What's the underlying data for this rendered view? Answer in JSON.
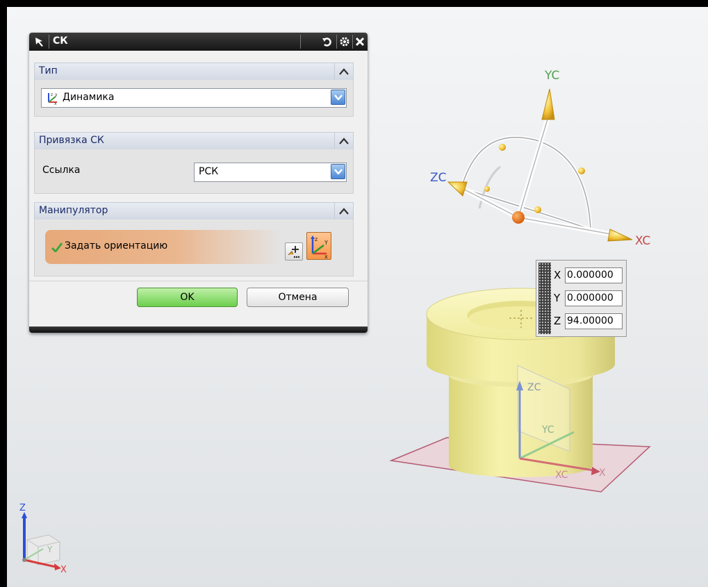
{
  "dialog": {
    "title": "СК",
    "sections": {
      "type": {
        "header": "Тип",
        "selected": "Динамика"
      },
      "snap": {
        "header": "Привязка СК",
        "reference_label": "Ссылка",
        "reference_value": "РСК"
      },
      "manipulator": {
        "header": "Манипулятор",
        "action_label": "Задать ориентацию"
      }
    },
    "ok_label": "OK",
    "cancel_label": "Отмена"
  },
  "manipulator_axes": {
    "yc": "YC",
    "zc": "ZC",
    "xc": "XC"
  },
  "coordinates": {
    "x_label": "X",
    "x_value": "0.000000",
    "y_label": "Y",
    "y_value": "0.000000",
    "z_label": "Z",
    "z_value": "94.00000"
  },
  "part_triad": {
    "zc": "ZC",
    "yc": "YC",
    "xc": "XC",
    "x": "X"
  },
  "view_triad": {
    "z": "Z",
    "y": "Y",
    "x": "X"
  },
  "colors": {
    "part_yellow": "#f2ee9c",
    "handle_orange": "#f0c33c",
    "axis_label_blue": "#3a58c8",
    "axis_label_green": "#52a052",
    "ok_green": "#6ccf4d",
    "header_blue": "#1a2a66"
  }
}
